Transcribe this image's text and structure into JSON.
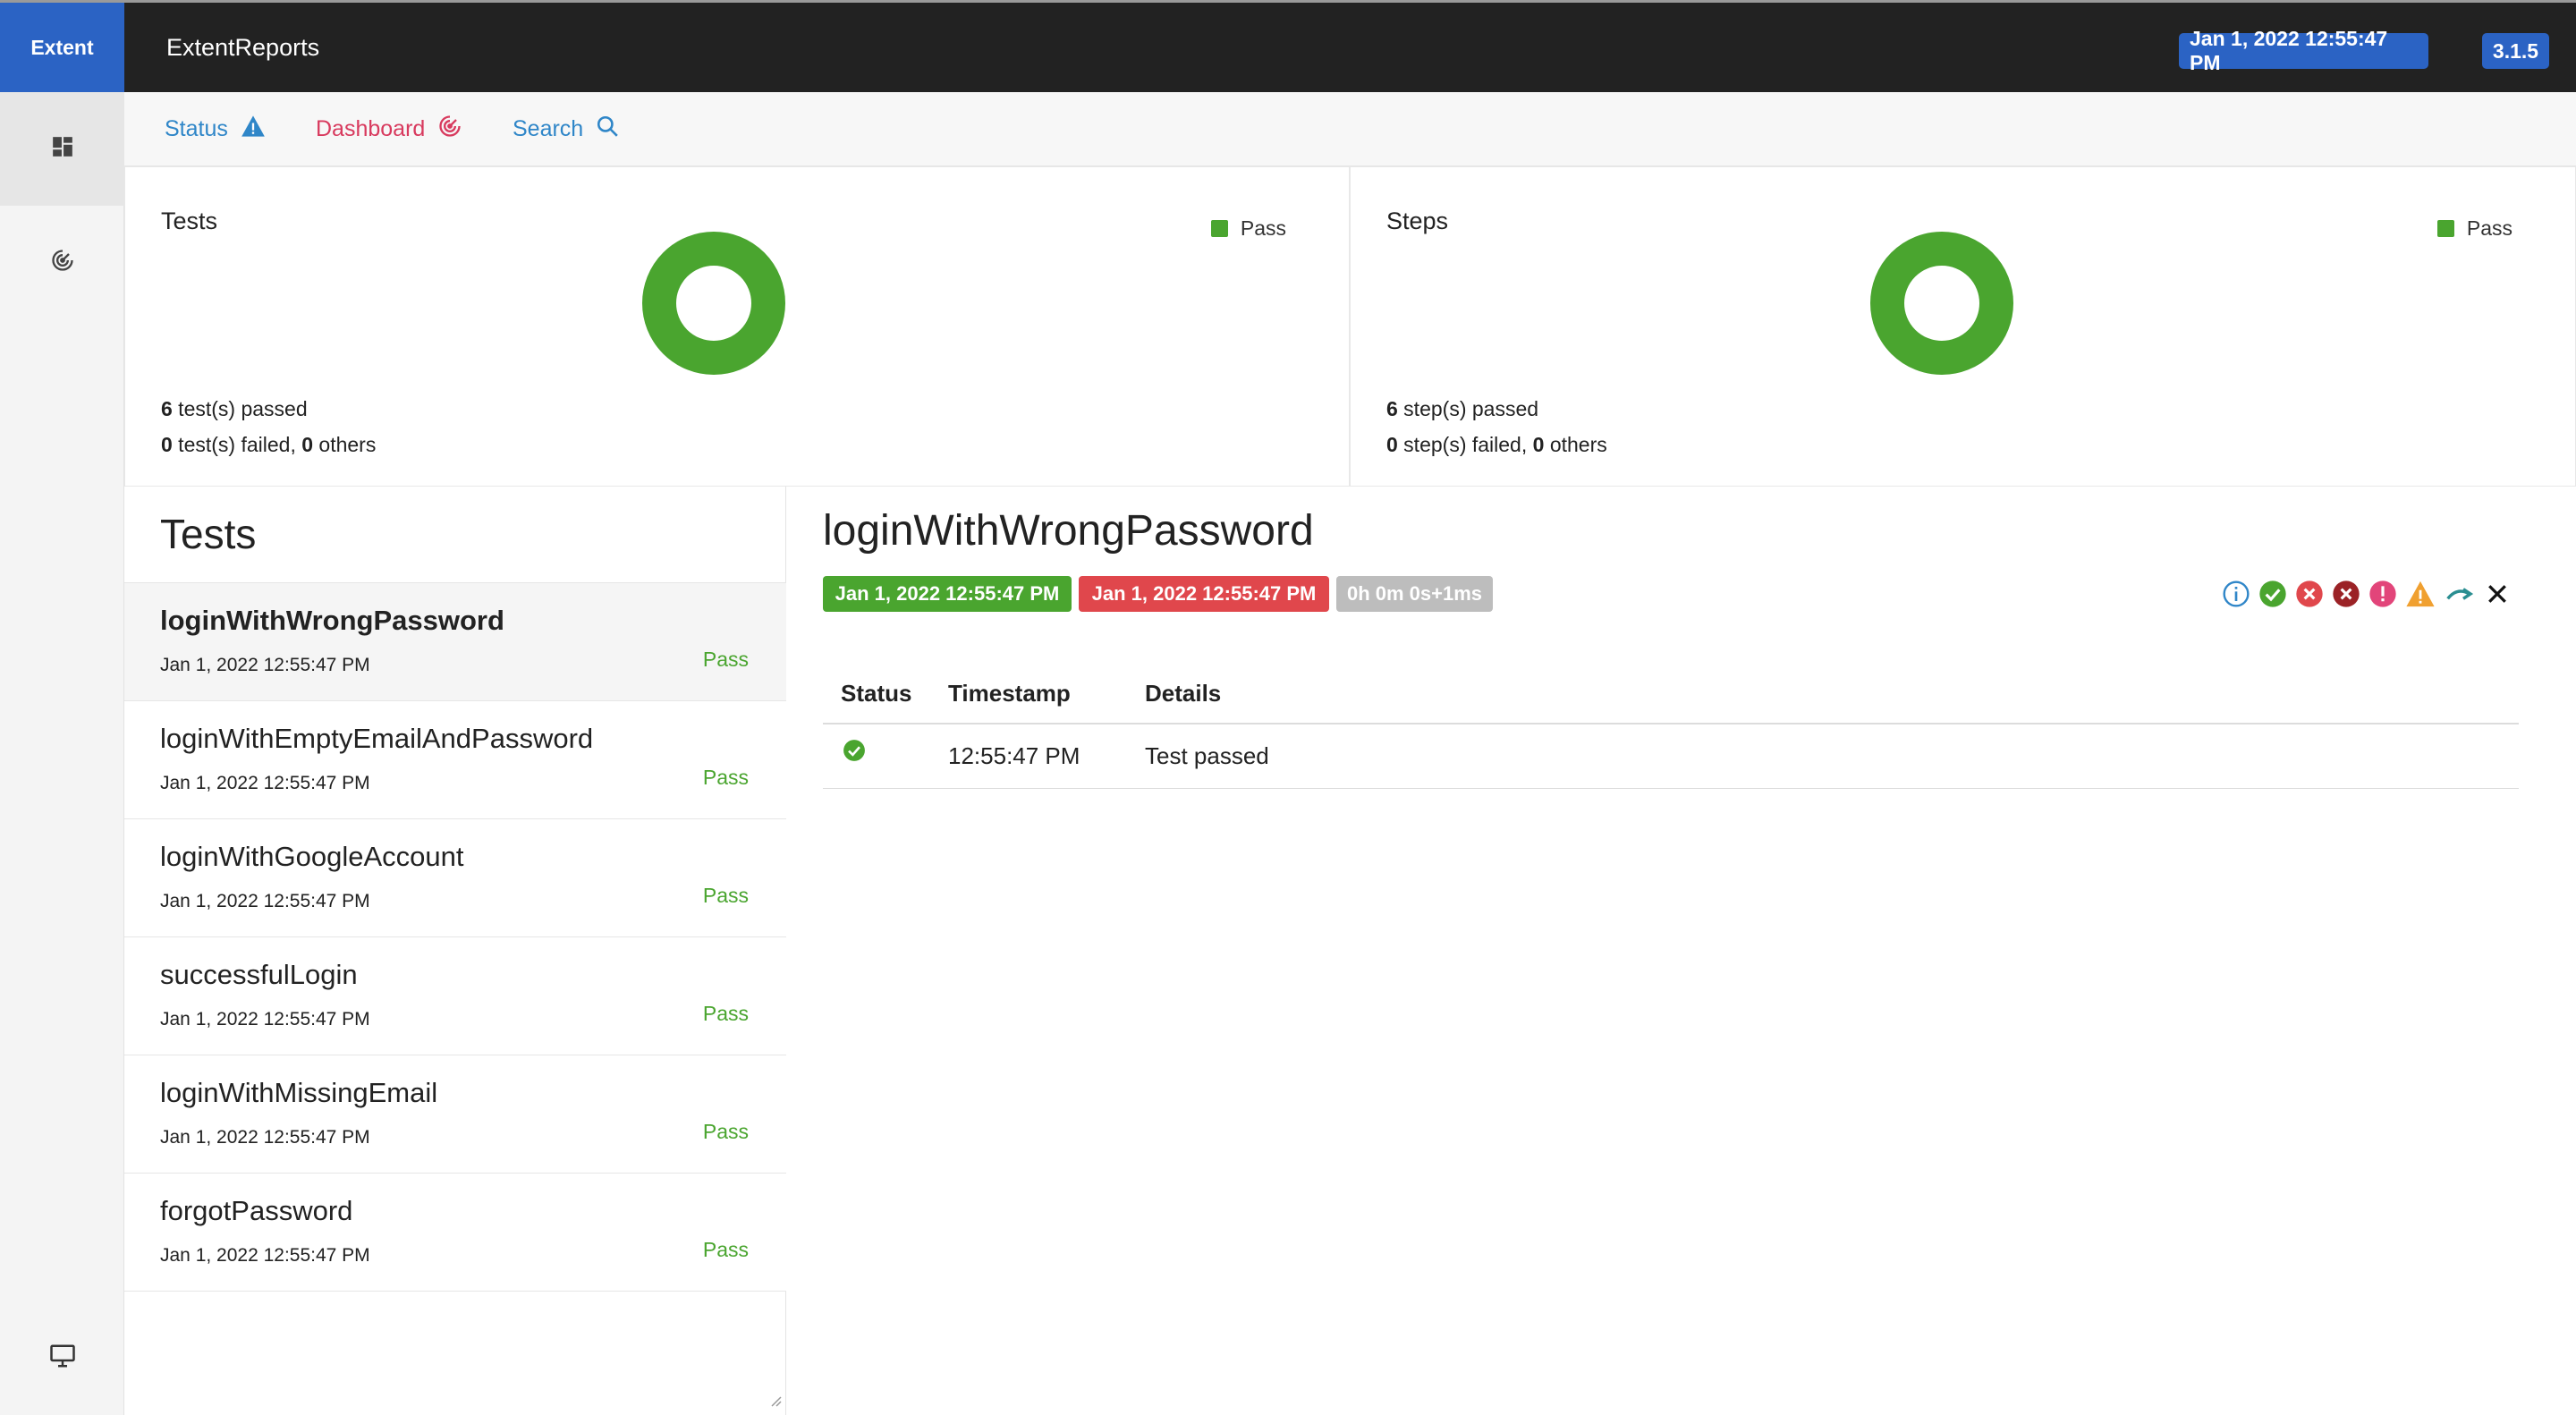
{
  "topbar": {
    "brand": "Extent",
    "app_title": "ExtentReports",
    "timestamp": "Jan 1, 2022 12:55:47 PM",
    "version": "3.1.5"
  },
  "sidebar": {
    "items": [
      {
        "icon": "dashboard-grid-icon",
        "active": true
      },
      {
        "icon": "radar-icon",
        "active": false
      }
    ],
    "bottom_icon": "monitor-icon"
  },
  "nav": {
    "status_label": "Status",
    "dashboard_label": "Dashboard",
    "search_label": "Search"
  },
  "summary": {
    "tests": {
      "title": "Tests",
      "legend": "Pass",
      "passed_count": "6",
      "passed_text": " test(s) passed",
      "failed_count": "0",
      "failed_text": " test(s) failed, ",
      "others_count": "0",
      "others_text": " others",
      "pass_fraction": 1.0
    },
    "steps": {
      "title": "Steps",
      "legend": "Pass",
      "passed_count": "6",
      "passed_text": " step(s) passed",
      "failed_count": "0",
      "failed_text": " step(s) failed, ",
      "others_count": "0",
      "others_text": " others",
      "pass_fraction": 1.0
    },
    "pass_color": "#4aa52f"
  },
  "tests_list": {
    "header": "Tests",
    "items": [
      {
        "name": "loginWithWrongPassword",
        "time": "Jan 1, 2022 12:55:47 PM",
        "status": "Pass"
      },
      {
        "name": "loginWithEmptyEmailAndPassword",
        "time": "Jan 1, 2022 12:55:47 PM",
        "status": "Pass"
      },
      {
        "name": "loginWithGoogleAccount",
        "time": "Jan 1, 2022 12:55:47 PM",
        "status": "Pass"
      },
      {
        "name": "successfulLogin",
        "time": "Jan 1, 2022 12:55:47 PM",
        "status": "Pass"
      },
      {
        "name": "loginWithMissingEmail",
        "time": "Jan 1, 2022 12:55:47 PM",
        "status": "Pass"
      },
      {
        "name": "forgotPassword",
        "time": "Jan 1, 2022 12:55:47 PM",
        "status": "Pass"
      }
    ]
  },
  "detail": {
    "title": "loginWithWrongPassword",
    "start_time": "Jan 1, 2022 12:55:47 PM",
    "end_time": "Jan 1, 2022 12:55:47 PM",
    "duration": "0h 0m 0s+1ms",
    "filters": [
      "info-icon",
      "pass-icon",
      "fail-icon",
      "fatal-icon",
      "error-icon",
      "warning-icon",
      "skip-icon",
      "clear-filter-icon"
    ],
    "log": {
      "headers": {
        "status": "Status",
        "timestamp": "Timestamp",
        "details": "Details"
      },
      "rows": [
        {
          "status_icon": "pass-check-icon",
          "timestamp": "12:55:47 PM",
          "details": "Test passed"
        }
      ]
    }
  }
}
